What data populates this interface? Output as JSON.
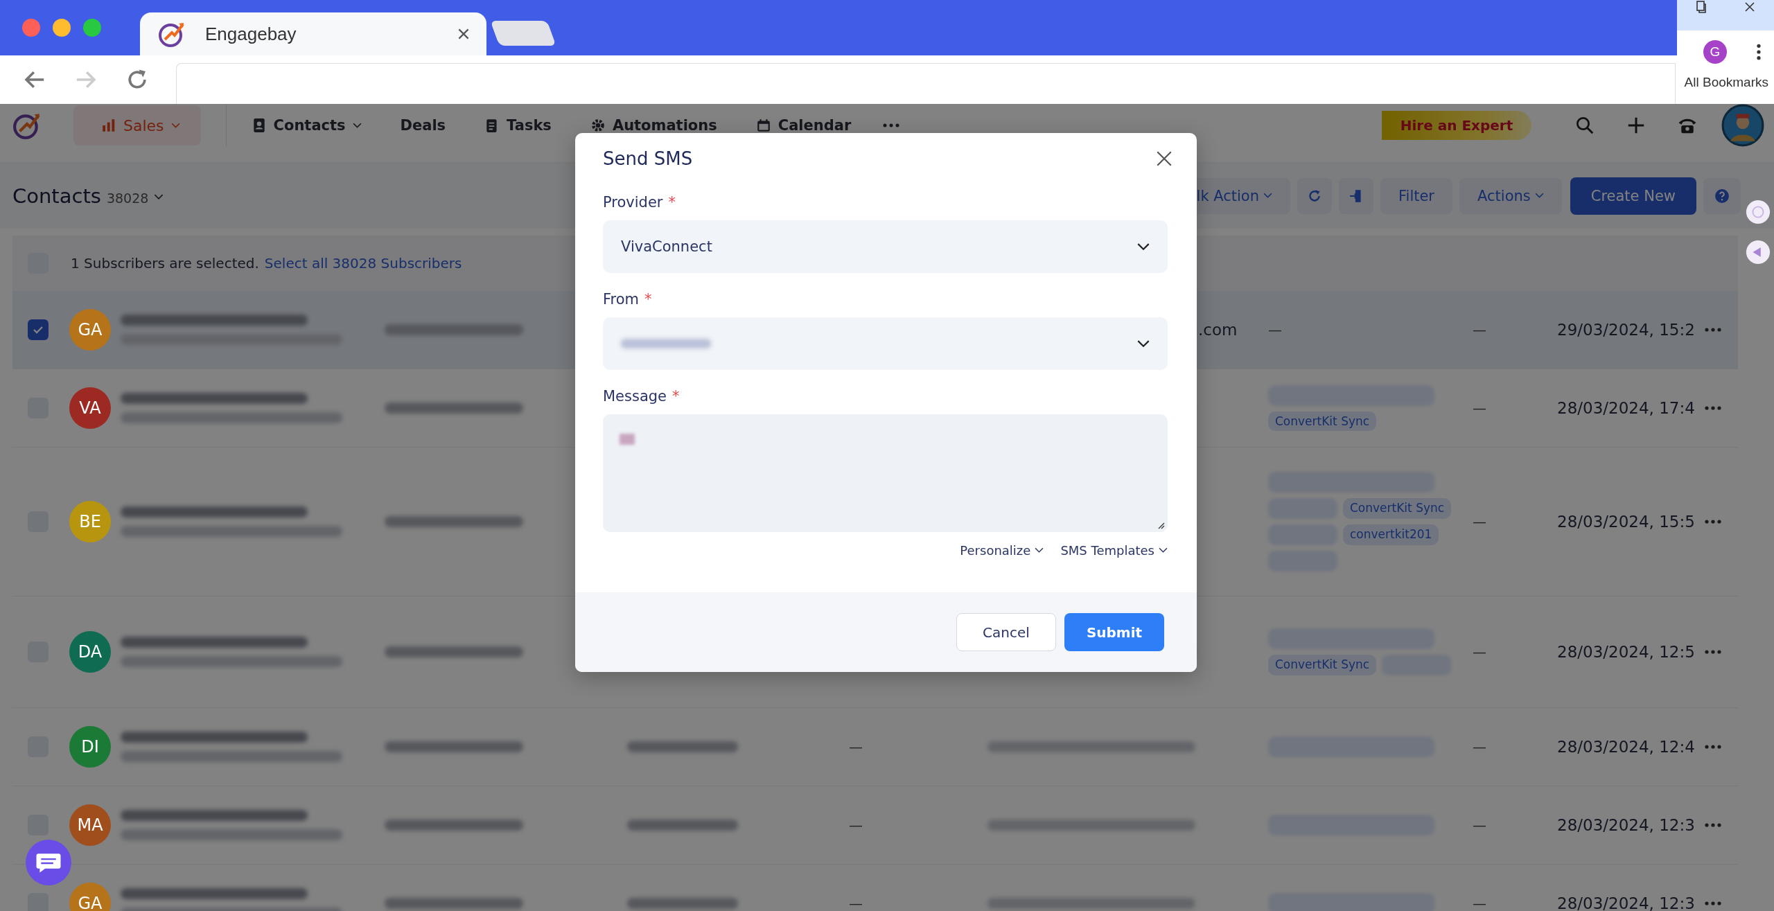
{
  "browser": {
    "tab_title": "Engagebay",
    "profile_initial": "G",
    "bookmarks_label": "All Bookmarks"
  },
  "app": {
    "module": {
      "label": "Sales",
      "has_caret": true
    },
    "nav": [
      {
        "label": "Contacts",
        "has_caret": true
      },
      {
        "label": "Deals",
        "has_caret": false
      },
      {
        "label": "Tasks",
        "has_caret": false
      },
      {
        "label": "Automations",
        "has_caret": false
      },
      {
        "label": "Calendar",
        "has_caret": false
      }
    ],
    "hire_button": "Hire an Expert",
    "page_title": "Contacts",
    "count": "38028",
    "toolbar": {
      "bulk_action": "lk Action",
      "filter": "Filter",
      "actions": "Actions",
      "create": "Create New"
    },
    "selection": {
      "checked": false,
      "text": "1 Subscribers are selected.",
      "link": "Select all 38028 Subscribers"
    }
  },
  "table": {
    "rows": [
      {
        "checked": true,
        "initials": "GA",
        "color": "#b5731a",
        "email_tail": ".com",
        "tags_text": "—",
        "column_7": "—",
        "date": "29/03/2024, 15:2"
      },
      {
        "checked": false,
        "initials": "VA",
        "color": "#9c2a22",
        "tags": [
          {
            "kind": "blurred"
          },
          {
            "kind": "text",
            "label": "ConvertKit Sync"
          }
        ],
        "column_7": "—",
        "date": "28/03/2024, 17:4"
      },
      {
        "checked": false,
        "initials": "BE",
        "color": "#b8950e",
        "tags": [
          {
            "kind": "blurred"
          },
          {
            "kind": "blurred"
          },
          {
            "kind": "text",
            "label": "ConvertKit Sync"
          },
          {
            "kind": "blurred"
          },
          {
            "kind": "text",
            "label": "convertkit201"
          },
          {
            "kind": "blurred"
          }
        ],
        "column_7": "—",
        "date": "28/03/2024, 15:5"
      },
      {
        "checked": false,
        "initials": "DA",
        "color": "#0f6b52",
        "tags": [
          {
            "kind": "blurred"
          },
          {
            "kind": "text",
            "label": "ConvertKit Sync"
          },
          {
            "kind": "blurred"
          }
        ],
        "column_7": "—",
        "date": "28/03/2024, 12:5"
      },
      {
        "checked": false,
        "initials": "DI",
        "color": "#1b7a35",
        "column_4": "—",
        "tags": [
          {
            "kind": "blurred"
          }
        ],
        "column_7": "—",
        "date": "28/03/2024, 12:4"
      },
      {
        "checked": false,
        "initials": "MA",
        "color": "#a04f1c",
        "column_4": "—",
        "tags": [
          {
            "kind": "blurred"
          }
        ],
        "column_7": "—",
        "date": "28/03/2024, 12:3"
      },
      {
        "checked": false,
        "initials": "GA",
        "color": "#b5731a",
        "column_4": "—",
        "tags": [
          {
            "kind": "blurred"
          }
        ],
        "column_7": "—",
        "date": "28/03/2024, 12:3"
      }
    ]
  },
  "modal": {
    "title": "Send SMS",
    "fields": [
      {
        "label": "Provider",
        "required_mark": "*",
        "kind": "select",
        "value": "VivaConnect"
      },
      {
        "label": "From",
        "required_mark": "*",
        "kind": "select",
        "blurred": true
      },
      {
        "label": "Message",
        "required_mark": "*",
        "kind": "textarea",
        "blurred": true
      }
    ],
    "links": [
      "Personalize",
      "SMS Templates"
    ],
    "buttons": [
      {
        "label": "Cancel",
        "kind": "secondary"
      },
      {
        "label": "Submit",
        "kind": "primary"
      }
    ]
  }
}
